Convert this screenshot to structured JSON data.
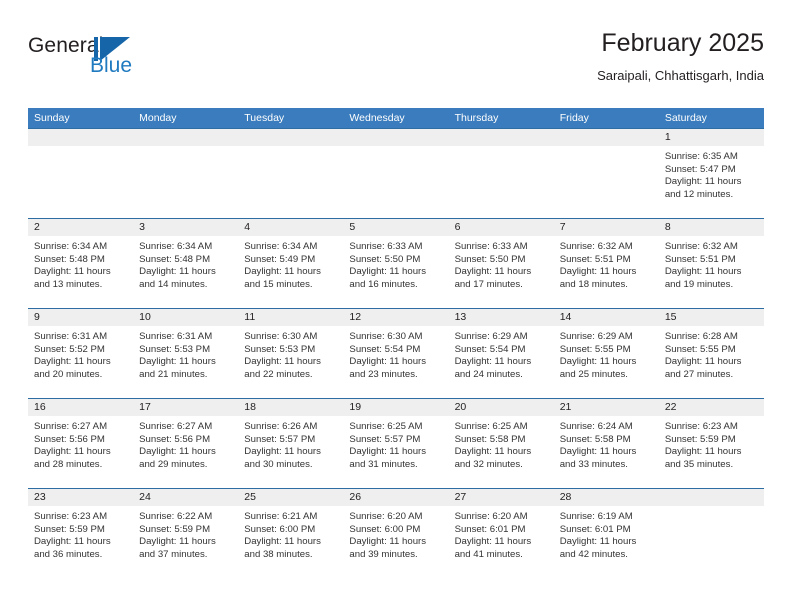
{
  "brand": {
    "name_part1": "General",
    "name_part2": "Blue",
    "mark": "sail-triangle-logo"
  },
  "header": {
    "title": "February 2025",
    "subtitle": "Saraipali, Chhattisgarh, India"
  },
  "colors": {
    "header_blue": "#3a7cbd",
    "row_border_blue": "#2e6da4",
    "daynum_bg": "#efeff0",
    "brand_blue": "#1f7ac0",
    "text": "#231f20"
  },
  "weekday_headers": [
    "Sunday",
    "Monday",
    "Tuesday",
    "Wednesday",
    "Thursday",
    "Friday",
    "Saturday"
  ],
  "weeks": [
    [
      {
        "day": "",
        "sunrise": "",
        "sunset": "",
        "daylight1": "",
        "daylight2": ""
      },
      {
        "day": "",
        "sunrise": "",
        "sunset": "",
        "daylight1": "",
        "daylight2": ""
      },
      {
        "day": "",
        "sunrise": "",
        "sunset": "",
        "daylight1": "",
        "daylight2": ""
      },
      {
        "day": "",
        "sunrise": "",
        "sunset": "",
        "daylight1": "",
        "daylight2": ""
      },
      {
        "day": "",
        "sunrise": "",
        "sunset": "",
        "daylight1": "",
        "daylight2": ""
      },
      {
        "day": "",
        "sunrise": "",
        "sunset": "",
        "daylight1": "",
        "daylight2": ""
      },
      {
        "day": "1",
        "sunrise": "Sunrise: 6:35 AM",
        "sunset": "Sunset: 5:47 PM",
        "daylight1": "Daylight: 11 hours",
        "daylight2": "and 12 minutes."
      }
    ],
    [
      {
        "day": "2",
        "sunrise": "Sunrise: 6:34 AM",
        "sunset": "Sunset: 5:48 PM",
        "daylight1": "Daylight: 11 hours",
        "daylight2": "and 13 minutes."
      },
      {
        "day": "3",
        "sunrise": "Sunrise: 6:34 AM",
        "sunset": "Sunset: 5:48 PM",
        "daylight1": "Daylight: 11 hours",
        "daylight2": "and 14 minutes."
      },
      {
        "day": "4",
        "sunrise": "Sunrise: 6:34 AM",
        "sunset": "Sunset: 5:49 PM",
        "daylight1": "Daylight: 11 hours",
        "daylight2": "and 15 minutes."
      },
      {
        "day": "5",
        "sunrise": "Sunrise: 6:33 AM",
        "sunset": "Sunset: 5:50 PM",
        "daylight1": "Daylight: 11 hours",
        "daylight2": "and 16 minutes."
      },
      {
        "day": "6",
        "sunrise": "Sunrise: 6:33 AM",
        "sunset": "Sunset: 5:50 PM",
        "daylight1": "Daylight: 11 hours",
        "daylight2": "and 17 minutes."
      },
      {
        "day": "7",
        "sunrise": "Sunrise: 6:32 AM",
        "sunset": "Sunset: 5:51 PM",
        "daylight1": "Daylight: 11 hours",
        "daylight2": "and 18 minutes."
      },
      {
        "day": "8",
        "sunrise": "Sunrise: 6:32 AM",
        "sunset": "Sunset: 5:51 PM",
        "daylight1": "Daylight: 11 hours",
        "daylight2": "and 19 minutes."
      }
    ],
    [
      {
        "day": "9",
        "sunrise": "Sunrise: 6:31 AM",
        "sunset": "Sunset: 5:52 PM",
        "daylight1": "Daylight: 11 hours",
        "daylight2": "and 20 minutes."
      },
      {
        "day": "10",
        "sunrise": "Sunrise: 6:31 AM",
        "sunset": "Sunset: 5:53 PM",
        "daylight1": "Daylight: 11 hours",
        "daylight2": "and 21 minutes."
      },
      {
        "day": "11",
        "sunrise": "Sunrise: 6:30 AM",
        "sunset": "Sunset: 5:53 PM",
        "daylight1": "Daylight: 11 hours",
        "daylight2": "and 22 minutes."
      },
      {
        "day": "12",
        "sunrise": "Sunrise: 6:30 AM",
        "sunset": "Sunset: 5:54 PM",
        "daylight1": "Daylight: 11 hours",
        "daylight2": "and 23 minutes."
      },
      {
        "day": "13",
        "sunrise": "Sunrise: 6:29 AM",
        "sunset": "Sunset: 5:54 PM",
        "daylight1": "Daylight: 11 hours",
        "daylight2": "and 24 minutes."
      },
      {
        "day": "14",
        "sunrise": "Sunrise: 6:29 AM",
        "sunset": "Sunset: 5:55 PM",
        "daylight1": "Daylight: 11 hours",
        "daylight2": "and 25 minutes."
      },
      {
        "day": "15",
        "sunrise": "Sunrise: 6:28 AM",
        "sunset": "Sunset: 5:55 PM",
        "daylight1": "Daylight: 11 hours",
        "daylight2": "and 27 minutes."
      }
    ],
    [
      {
        "day": "16",
        "sunrise": "Sunrise: 6:27 AM",
        "sunset": "Sunset: 5:56 PM",
        "daylight1": "Daylight: 11 hours",
        "daylight2": "and 28 minutes."
      },
      {
        "day": "17",
        "sunrise": "Sunrise: 6:27 AM",
        "sunset": "Sunset: 5:56 PM",
        "daylight1": "Daylight: 11 hours",
        "daylight2": "and 29 minutes."
      },
      {
        "day": "18",
        "sunrise": "Sunrise: 6:26 AM",
        "sunset": "Sunset: 5:57 PM",
        "daylight1": "Daylight: 11 hours",
        "daylight2": "and 30 minutes."
      },
      {
        "day": "19",
        "sunrise": "Sunrise: 6:25 AM",
        "sunset": "Sunset: 5:57 PM",
        "daylight1": "Daylight: 11 hours",
        "daylight2": "and 31 minutes."
      },
      {
        "day": "20",
        "sunrise": "Sunrise: 6:25 AM",
        "sunset": "Sunset: 5:58 PM",
        "daylight1": "Daylight: 11 hours",
        "daylight2": "and 32 minutes."
      },
      {
        "day": "21",
        "sunrise": "Sunrise: 6:24 AM",
        "sunset": "Sunset: 5:58 PM",
        "daylight1": "Daylight: 11 hours",
        "daylight2": "and 33 minutes."
      },
      {
        "day": "22",
        "sunrise": "Sunrise: 6:23 AM",
        "sunset": "Sunset: 5:59 PM",
        "daylight1": "Daylight: 11 hours",
        "daylight2": "and 35 minutes."
      }
    ],
    [
      {
        "day": "23",
        "sunrise": "Sunrise: 6:23 AM",
        "sunset": "Sunset: 5:59 PM",
        "daylight1": "Daylight: 11 hours",
        "daylight2": "and 36 minutes."
      },
      {
        "day": "24",
        "sunrise": "Sunrise: 6:22 AM",
        "sunset": "Sunset: 5:59 PM",
        "daylight1": "Daylight: 11 hours",
        "daylight2": "and 37 minutes."
      },
      {
        "day": "25",
        "sunrise": "Sunrise: 6:21 AM",
        "sunset": "Sunset: 6:00 PM",
        "daylight1": "Daylight: 11 hours",
        "daylight2": "and 38 minutes."
      },
      {
        "day": "26",
        "sunrise": "Sunrise: 6:20 AM",
        "sunset": "Sunset: 6:00 PM",
        "daylight1": "Daylight: 11 hours",
        "daylight2": "and 39 minutes."
      },
      {
        "day": "27",
        "sunrise": "Sunrise: 6:20 AM",
        "sunset": "Sunset: 6:01 PM",
        "daylight1": "Daylight: 11 hours",
        "daylight2": "and 41 minutes."
      },
      {
        "day": "28",
        "sunrise": "Sunrise: 6:19 AM",
        "sunset": "Sunset: 6:01 PM",
        "daylight1": "Daylight: 11 hours",
        "daylight2": "and 42 minutes."
      },
      {
        "day": "",
        "sunrise": "",
        "sunset": "",
        "daylight1": "",
        "daylight2": ""
      }
    ]
  ]
}
